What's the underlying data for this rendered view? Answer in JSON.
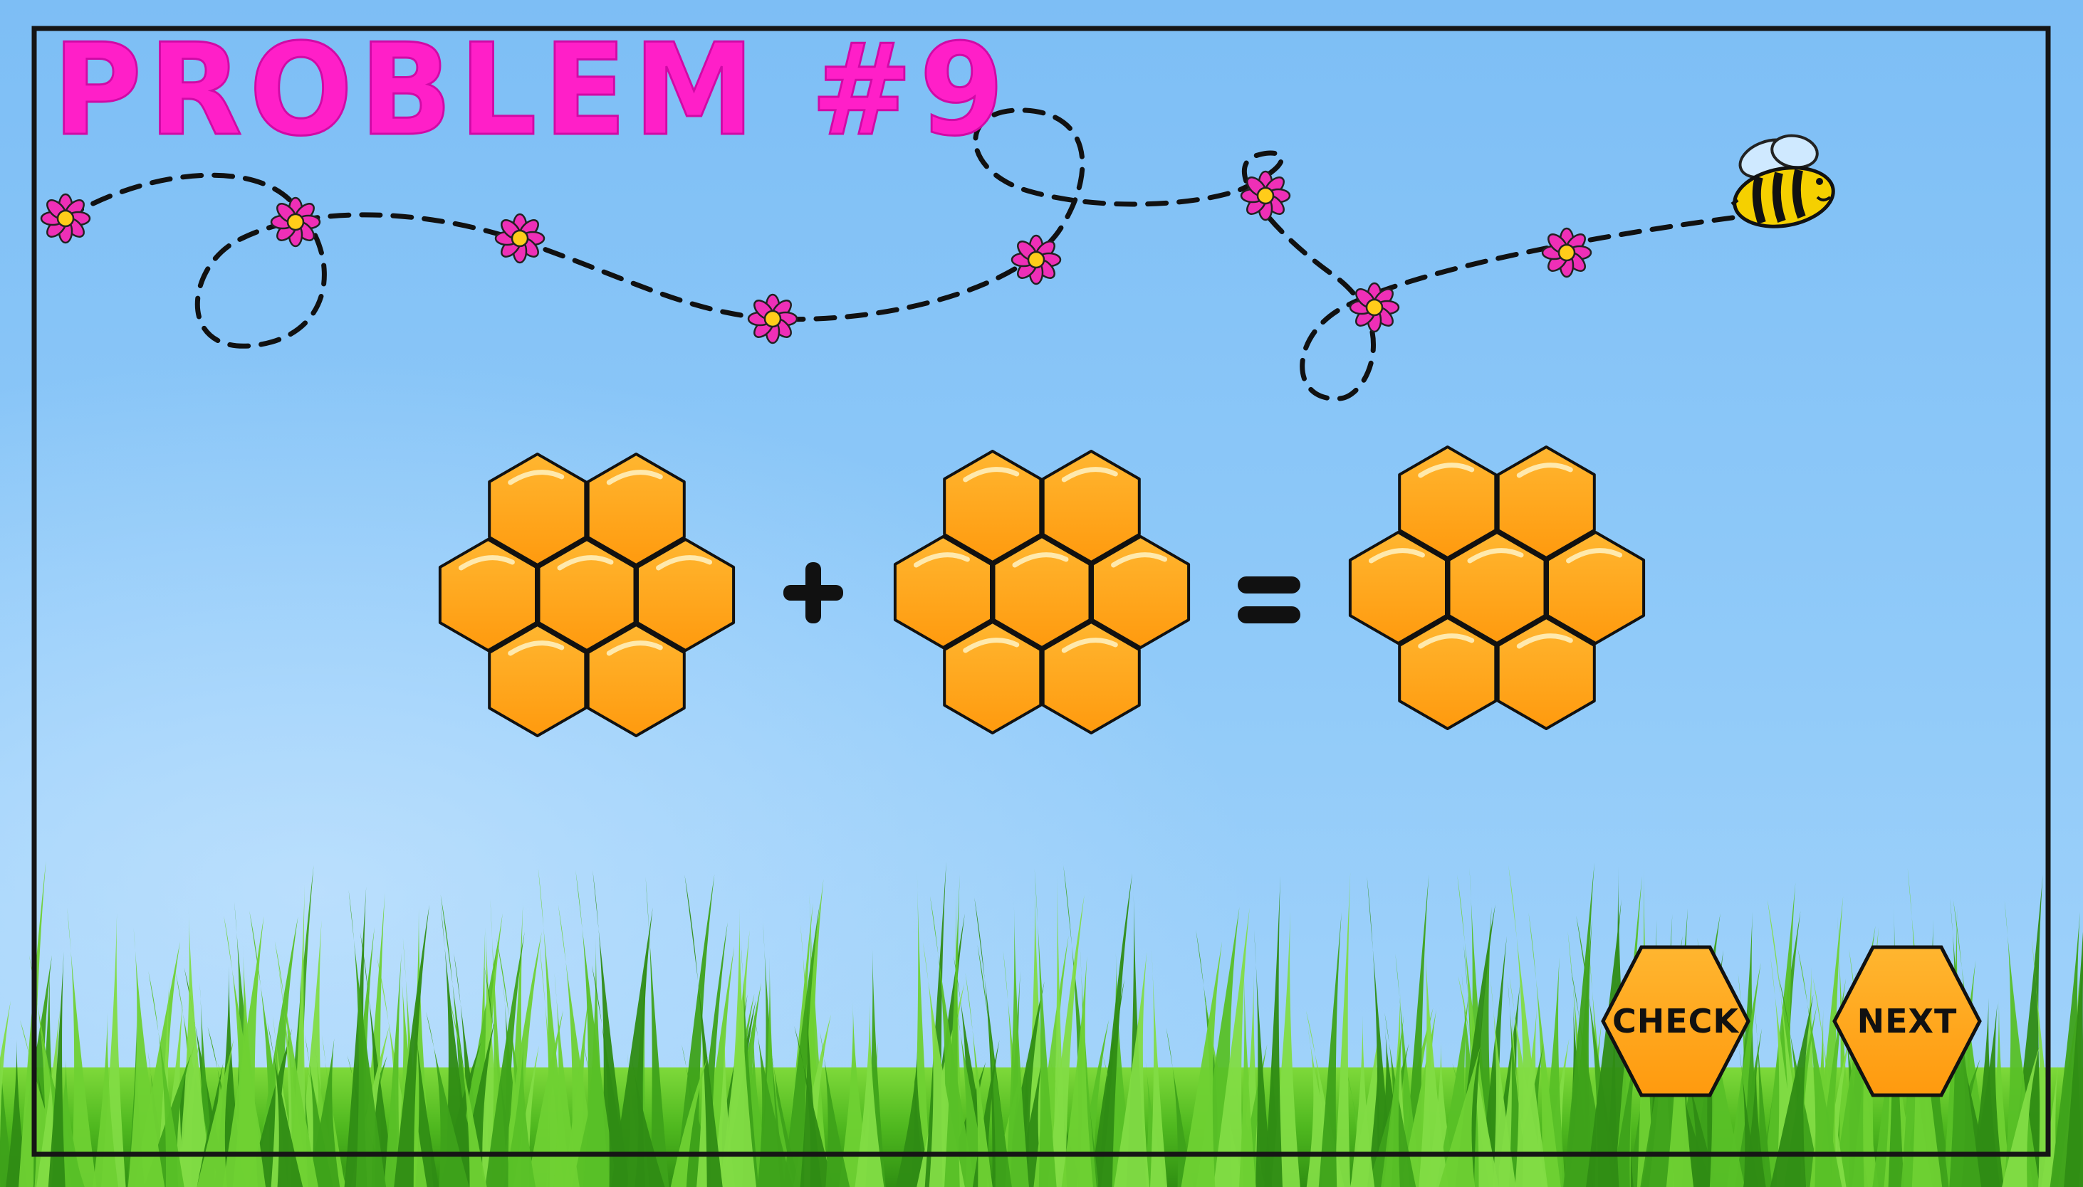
{
  "title": "PROBLEM #9",
  "equation": {
    "operand_a_cells": 7,
    "operator": "+",
    "operand_b_cells": 7,
    "equals": "=",
    "result_cells": 7
  },
  "buttons": {
    "check_label": "CHECK",
    "next_label": "NEXT"
  },
  "colors": {
    "title": "#ff1fc8",
    "sky": "#8ec8f6",
    "honeycomb": "#ffa51a",
    "grass": "#5cc425",
    "flower": "#ef2fb7",
    "bee_stripe": "#f5d000"
  },
  "icons": [
    "bee-icon",
    "flower-icon",
    "honeycomb-icon"
  ]
}
